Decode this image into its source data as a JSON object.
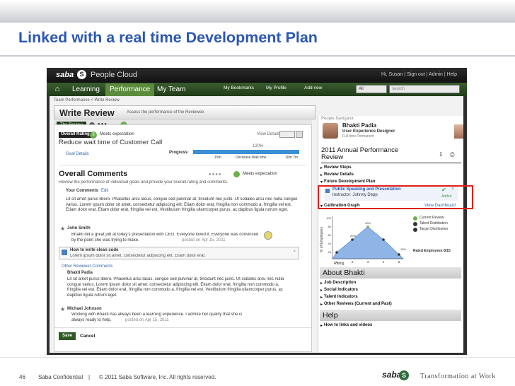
{
  "slide": {
    "title": "Linked with a real time Development Plan",
    "page_number": "46",
    "confidential": "Saba Confidential",
    "separator": "|",
    "copyright": "© 2011 Saba Software, Inc. All rights reserved.",
    "footer_logo": "saba",
    "footer_logo_mark": "S",
    "tagline": "Transformation at Work"
  },
  "app": {
    "logo": "saba",
    "logo_mark": "S",
    "product": "People Cloud",
    "header_links": "Hi, Susan | Sign out | Admin | Help",
    "home_icon": "⌂",
    "nav_tabs": [
      "Learning",
      "Performance",
      "My Team"
    ],
    "nav_right": [
      "My Bookmarks",
      "My Profile",
      "Add new"
    ],
    "scope_select": "All",
    "search_placeholder": "search"
  },
  "review": {
    "breadcrumb": "Team Performance  <  Write Review",
    "title": "Write Review",
    "subtitle": "Assess the performance of the Reviewee",
    "tab_label": "The Review",
    "rating_label": "Overall Rating",
    "rating_value": "3",
    "rating_text": "Meets expectation",
    "view_details": "View Details",
    "goal_title": "Reduce wait time of Customer Call",
    "goal_details": "Goal Details",
    "progress_label": "Progress:",
    "progress_pct": "120%",
    "progress_min": "15m",
    "progress_mid": "Decrease Wait time",
    "progress_max": "10m  7m",
    "overall_comments": "Overall Comments",
    "overall_rating_text": "Meets expectation",
    "overall_intro": "Review the performance of individual goals and provide your overall rating and comments.",
    "your_comments": "Your Comments",
    "edit": "Edit",
    "lorem1": "Lit sit amet purus libero. Phasellus arcu lacus, congue sed pulvinar at, tincidunt nec justo. Ut sodales arcu nec nulla congue varius. Lorem ipsum dolor sit amet, consectetur adipiscing elit. Etiam dolor erat, fringilla non commodo a, fringilla vel est. Etiam dolor erat. Etiam dolor erat, fringilla vel est. Vestibulum fringilla ullamcorper purus, ac dapibus ligula rutrum eget.",
    "john_name": "John Smith",
    "john_text": "Bhakti did a great job at today's presentation with CEO. Everyone loved it. Everyone was convinced by the point she was trying to make.",
    "john_date": "posted on Apr 15, 2011",
    "howto_title": "How to write clean code",
    "howto_text": "Lorem ipsum dolor sit amet, consectetur adipiscing elit. Etiam dolor erat.",
    "other_comments": "Other Reviewer Comments",
    "bhakti_name": "Bhakti Padia",
    "lorem2": "Lit sit amet purus libero. Phasellus arcu lacus, congue sed pulvinar at, tincidunt nec justo. Ut sodales arcu nec nulla congue varius. Lorem ipsum dolor sit amet, consectetur adipiscing elit. Etiam dolor erat, fringilla non commodo a, fringilla vel est. Etiam dolor erat, fringilla non commodo a, fringilla vel est. Vestibulum fringilla ullamcorper purus, ac dapibus ligula rutrum eget.",
    "michael_name": "Michael Johnson",
    "michael_text": "Working with Bhakti has always been a learning experience. I admire her quality that she is always ready to help.",
    "michael_date": "posted on Apr 15, 2011",
    "save": "Save",
    "cancel": "Cancel"
  },
  "right": {
    "navigator": "People Navigator",
    "person_name": "Bhakti Padia",
    "person_role": "User Experience Designer",
    "person_type": "Full time Permanent",
    "card_title": "2011 Annual Performance Review",
    "links": [
      "Review Steps",
      "Review Details",
      "Future Development Plan"
    ],
    "plan_title": "Public Speaking and Presentation",
    "plan_instructor": "Instructor: Johnny Depp",
    "plan_status": "Added",
    "calibration": "Calibration Graph",
    "view_dashboard": "View Dashboard",
    "legend": [
      "Current Review",
      "Talent Distribution",
      "Target Distribution"
    ],
    "graph_x_label": "Rating",
    "graph_y_label": "% of Employees",
    "graph_labels": [
      "20%",
      "40%",
      "15%"
    ],
    "rated_employees": "Rated Employees 8/15",
    "about": "About Bhakti",
    "about_links": [
      "Job Description",
      "Social Indicators",
      "Talent Indicators",
      "Other Reviews (Current and Past)"
    ],
    "help": "Help",
    "help_link": "How to links and videos"
  },
  "chart_data": {
    "type": "area",
    "x": [
      1,
      2,
      3,
      4,
      5
    ],
    "yticks": [
      100,
      80,
      60,
      40,
      20
    ],
    "y_axis_label": "% of Employees",
    "x_axis_label": "Rating",
    "annotations": [
      "20%",
      "40%",
      "15%"
    ]
  },
  "colors": {
    "title_blue": "#2c57b3",
    "nav_green": "#2e5a24",
    "highlight_red": "#e0201b",
    "chart_blue": "#8fb4e6"
  }
}
